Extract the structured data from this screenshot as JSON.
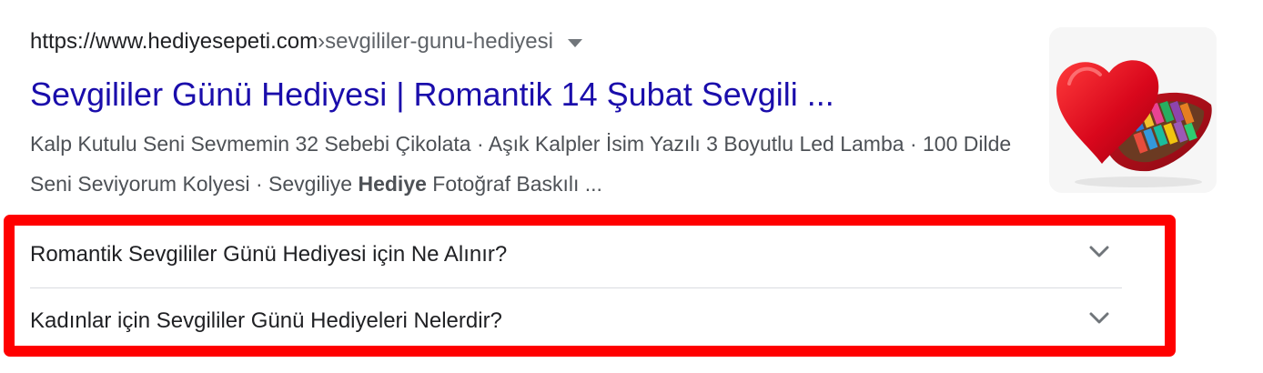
{
  "result": {
    "url_domain": "https://www.hediyesepeti.com",
    "url_separator": " › ",
    "url_path": "sevgililer-gunu-hediyesi",
    "menu_icon": "triangle-down-icon",
    "title": "Sevgililer Günü Hediyesi | Romantik 14 Şubat Sevgili ...",
    "snippet": {
      "part1": "Kalp Kutulu Seni Sevmemin 32 Sebebi Çikolata · Aşık Kalpler İsim Yazılı 3 Boyutlu Led Lamba · 100 Dilde Seni Seviyorum Kolyesi · Sevgiliye ",
      "bold": "Hediye",
      "part2": " Fotoğraf Baskılı ..."
    },
    "thumbnail_icon": "heart-chocolate-box-image"
  },
  "faq": {
    "items": [
      {
        "question": "Romantik Sevgililer Günü Hediyesi için Ne Alınır?"
      },
      {
        "question": "Kadınlar için Sevgililer Günü Hediyeleri Nelerdir?"
      }
    ],
    "expand_icon": "chevron-down-icon"
  },
  "colors": {
    "title_link": "#1a0dab",
    "url_text": "#202124",
    "snippet_text": "#4d5156",
    "highlight": "#ff0000"
  }
}
